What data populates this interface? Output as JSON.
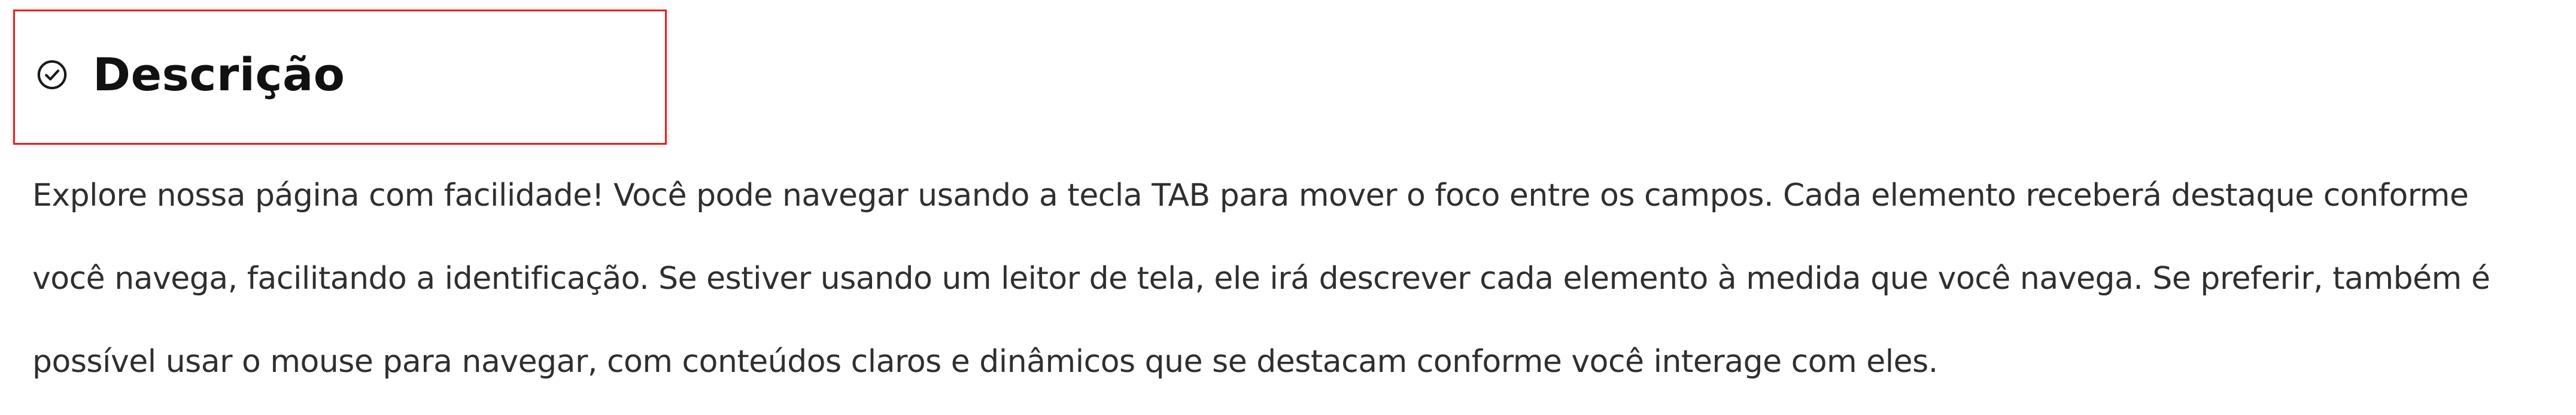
{
  "section": {
    "icon": "check-circle-icon",
    "title": "Descrição",
    "highlight_color": "#e02424",
    "paragraph": "Explore nossa página com facilidade! Você pode navegar usando a tecla TAB para mover o foco entre os campos. Cada elemento receberá destaque conforme você navega, facilitando a identificação. Se estiver usando um leitor de tela, ele irá descrever cada elemento à medida que você navega. Se preferir, também é possível usar o mouse para navegar, com conteúdos claros e dinâmicos que se destacam conforme você interage com eles."
  }
}
